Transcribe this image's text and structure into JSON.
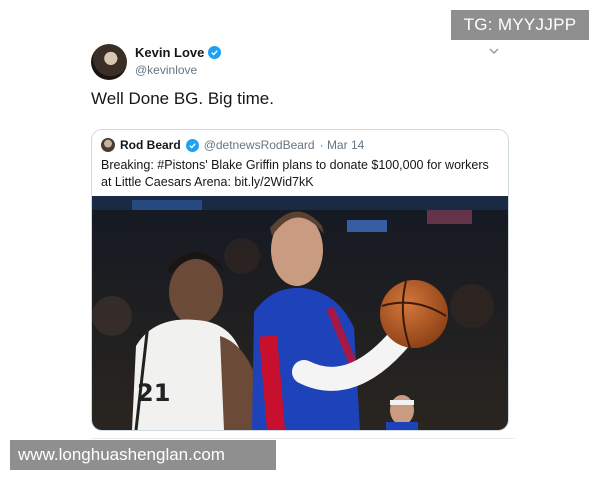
{
  "watermarks": {
    "top": "TG: MYYJJPP",
    "bottom": "www.longhuashenglan.com"
  },
  "tweet": {
    "author_name": "Kevin Love",
    "author_handle": "@kevinlove",
    "text": "Well Done BG. Big time."
  },
  "quoted_tweet": {
    "author_name": "Rod Beard",
    "author_handle": "@detnewsRodBeard",
    "date": "· Mar 14",
    "text": "Breaking: #Pistons' Blake Griffin plans to donate $100,000 for workers at Little Caesars Arena: bit.ly/2Wid7kK",
    "photo_jersey_number": "21"
  },
  "colors": {
    "verified_blue": "#1da1f2",
    "card_border": "#cfd9de",
    "pistons_red": "#c8102e",
    "pistons_blue": "#1d42ba"
  },
  "icons": {
    "verified": "verified-badge-icon",
    "menu": "chevron-down-icon"
  }
}
